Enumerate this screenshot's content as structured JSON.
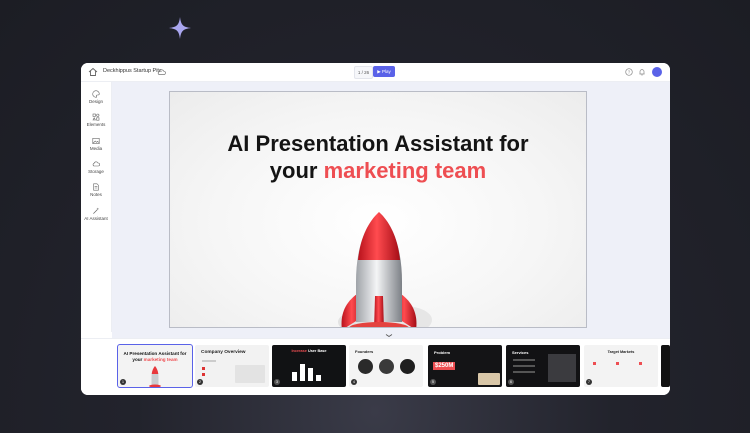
{
  "app": {
    "document_title": "Deckhippus Startup Pitc",
    "page_indicator": "1 / 26",
    "play_label": "Play"
  },
  "sidebar": {
    "items": [
      {
        "label": "Design",
        "icon": "palette-icon"
      },
      {
        "label": "Elements",
        "icon": "elements-icon"
      },
      {
        "label": "Media",
        "icon": "image-icon"
      },
      {
        "label": "Storage",
        "icon": "cloud-icon"
      },
      {
        "label": "Notes",
        "icon": "notes-icon"
      },
      {
        "label": "AI Assistant",
        "icon": "magic-wand-icon"
      }
    ]
  },
  "slide": {
    "title_line1": "AI Presentation Assistant for",
    "title_prefix": "your",
    "title_accent": "marketing team"
  },
  "thumbnails": [
    {
      "num": "1",
      "title_line1": "AI Presentation Assistant for",
      "title_prefix": "your",
      "title_accent": "marketing team"
    },
    {
      "num": "2",
      "title": "Company Overview"
    },
    {
      "num": "3",
      "title_prefix": "Increase",
      "title_rest": "User Base"
    },
    {
      "num": "4",
      "title": "Founders"
    },
    {
      "num": "5",
      "title": "Problem",
      "value": "$250M"
    },
    {
      "num": "6",
      "title": "Services"
    },
    {
      "num": "7",
      "title": "Target Markets"
    }
  ],
  "colors": {
    "accent": "#ee4e52",
    "primary": "#5a62e8"
  }
}
